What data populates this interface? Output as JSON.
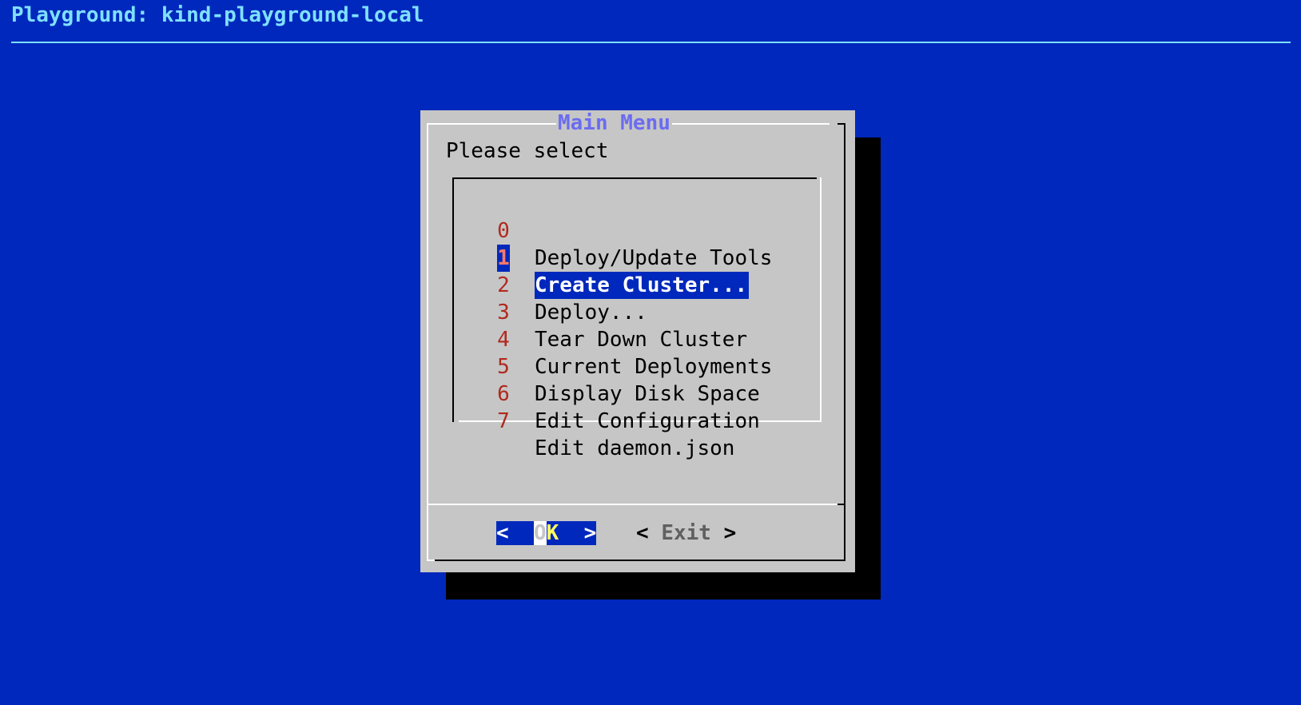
{
  "terminal": {
    "title": "Playground: kind-playground-local"
  },
  "dialog": {
    "title": "Main Menu",
    "prompt": "Please select",
    "menu": [
      {
        "tag": "0",
        "label": "Deploy/Update Tools",
        "selected": false
      },
      {
        "tag": "1",
        "label": "Create Cluster...",
        "selected": true
      },
      {
        "tag": "2",
        "label": "Deploy...",
        "selected": false
      },
      {
        "tag": "3",
        "label": "Tear Down Cluster",
        "selected": false
      },
      {
        "tag": "4",
        "label": "Current Deployments",
        "selected": false
      },
      {
        "tag": "5",
        "label": "Display Disk Space",
        "selected": false
      },
      {
        "tag": "6",
        "label": "Edit Configuration",
        "selected": false
      },
      {
        "tag": "7",
        "label": "Edit daemon.json",
        "selected": false
      }
    ],
    "buttons": {
      "ok": {
        "left": "<",
        "hot_first": "O",
        "hot_second": "K",
        "right": ">"
      },
      "exit": {
        "left": "< ",
        "label": "Exit",
        "right": " >"
      }
    }
  },
  "colors": {
    "background": "#0028bc",
    "dialog": "#c6c6c6",
    "title_text": "#7fe0ff",
    "dialog_title": "#6c6cf0",
    "menu_tag": "#b02a1e",
    "selection": "#0028bc",
    "hotkey": "#ffff60"
  }
}
